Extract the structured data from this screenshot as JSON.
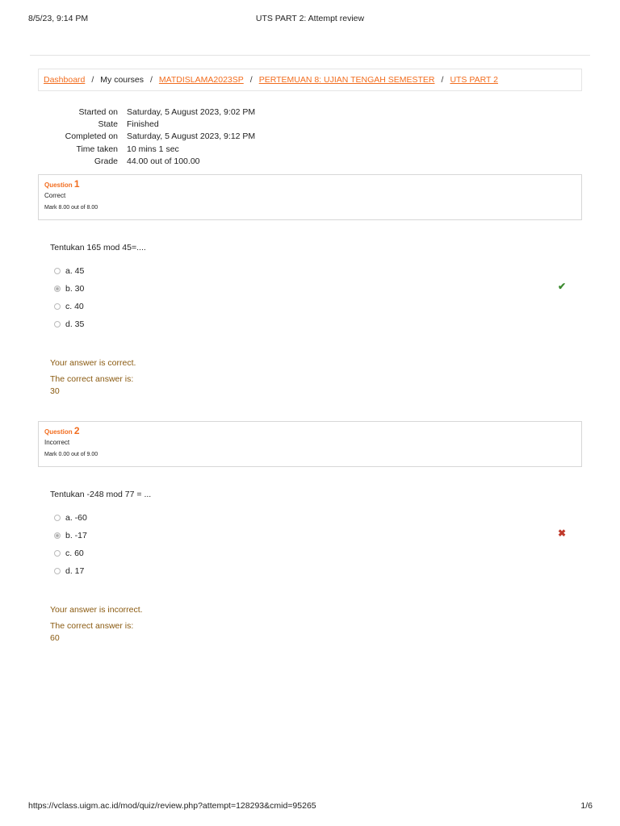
{
  "header": {
    "datetime": "8/5/23, 9:14 PM",
    "title": "UTS PART 2: Attempt review"
  },
  "breadcrumb": [
    {
      "label": "Dashboard",
      "link": true
    },
    {
      "label": "My courses",
      "link": false
    },
    {
      "label": "MATDISLAMA2023SP",
      "link": true
    },
    {
      "label": "PERTEMUAN 8: UJIAN TENGAH SEMESTER",
      "link": true
    },
    {
      "label": "UTS PART 2",
      "link": true
    }
  ],
  "summary": [
    {
      "label": "Started on",
      "value": "Saturday, 5 August 2023, 9:02 PM"
    },
    {
      "label": "State",
      "value": "Finished"
    },
    {
      "label": "Completed on",
      "value": "Saturday, 5 August 2023, 9:12 PM"
    },
    {
      "label": "Time taken",
      "value": "10 mins 1 sec"
    },
    {
      "label": "Grade",
      "value": "44.00 out of 100.00"
    }
  ],
  "questions": [
    {
      "word": "Question",
      "number": "1",
      "state": "Correct",
      "mark": "Mark 8.00 out of 8.00",
      "text": "Tentukan 165 mod 45=....",
      "options": [
        "a. 45",
        "b. 30",
        "c. 40",
        "d. 35"
      ],
      "selected": 1,
      "result_icon": "check-icon",
      "result_color": "#3b8a2e",
      "feedback": "Your answer is correct.",
      "correct_label": "The correct answer is:",
      "correct_value": "30"
    },
    {
      "word": "Question",
      "number": "2",
      "state": "Incorrect",
      "mark": "Mark 0.00 out of 9.00",
      "text": "Tentukan -248 mod 77 = ...",
      "options": [
        "a. -60",
        "b. -17",
        "c. 60",
        "d. 17"
      ],
      "selected": 1,
      "result_icon": "cross-icon",
      "result_color": "#c0392b",
      "feedback": "Your answer is incorrect.",
      "correct_label": "The correct answer is:",
      "correct_value": "60"
    }
  ],
  "footer": {
    "url": "https://vclass.uigm.ac.id/mod/quiz/review.php?attempt=128293&cmid=95265",
    "page": "1/6"
  }
}
